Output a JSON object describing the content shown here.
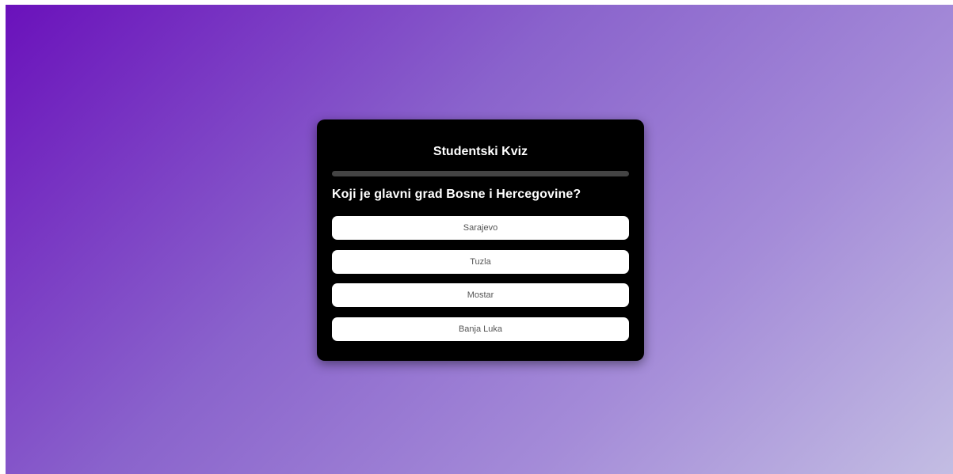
{
  "quiz": {
    "title": "Studentski Kviz",
    "progress_fraction": 0,
    "question": "Koji je glavni grad Bosne i Hercegovine?",
    "answers": [
      "Sarajevo",
      "Tuzla",
      "Mostar",
      "Banja Luka"
    ]
  },
  "colors": {
    "card_background": "#000000",
    "progress_track": "#444444",
    "gradient_start": "#6a11bb",
    "gradient_end": "#c3bde3"
  }
}
